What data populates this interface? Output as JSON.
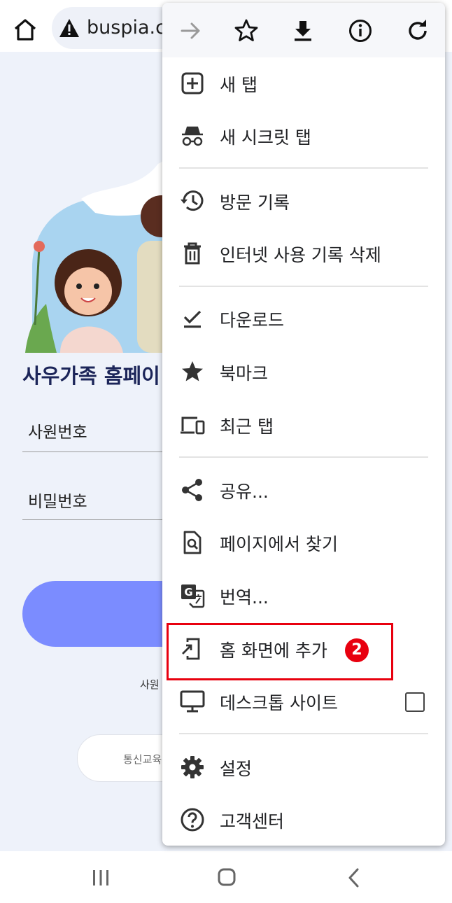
{
  "browser": {
    "url": "buspia.co"
  },
  "page": {
    "title": "사우가족 홈페이",
    "fields": [
      {
        "label": "사원번호"
      },
      {
        "label": "비밀번호"
      }
    ],
    "note": "사원",
    "pill_button": "통신교육"
  },
  "menu": {
    "items": [
      {
        "label": "새 탭"
      },
      {
        "label": "새 시크릿 탭"
      },
      {
        "label": "방문 기록"
      },
      {
        "label": "인터넷 사용 기록 삭제"
      },
      {
        "label": "다운로드"
      },
      {
        "label": "북마크"
      },
      {
        "label": "최근 탭"
      },
      {
        "label": "공유..."
      },
      {
        "label": "페이지에서 찾기"
      },
      {
        "label": "번역..."
      },
      {
        "label": "홈 화면에 추가"
      },
      {
        "label": "데스크톱 사이트"
      },
      {
        "label": "설정"
      },
      {
        "label": "고객센터"
      }
    ],
    "desktop_site_checked": false
  },
  "annotation": {
    "step": "2"
  },
  "colors": {
    "highlight": "#e8000f",
    "login_button": "#7b8cff",
    "page_background": "#eef2fa",
    "title": "#1c2559"
  }
}
